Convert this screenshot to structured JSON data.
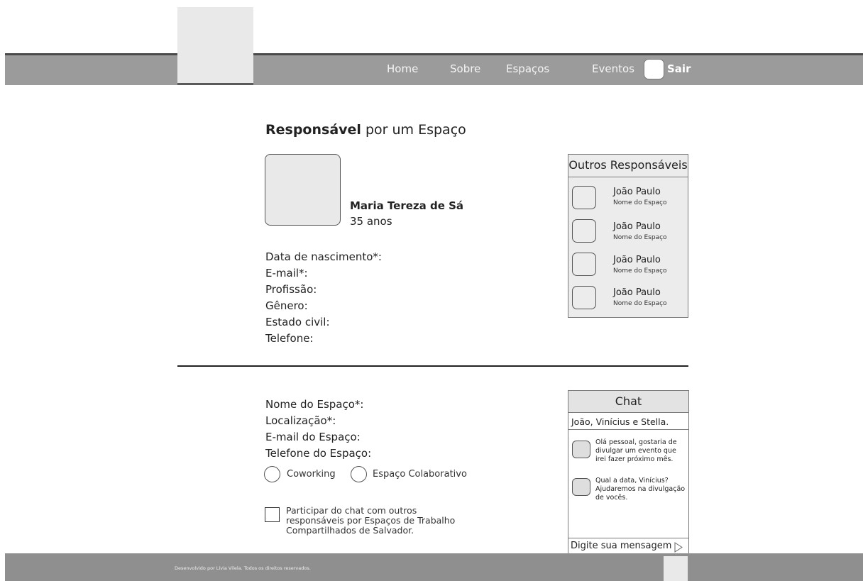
{
  "header": {
    "nav": [
      "Home",
      "Sobre",
      "Espaços",
      "Eventos"
    ],
    "logout_label": "Sair"
  },
  "page": {
    "title_bold": "Responsável",
    "title_rest": " por um Espaço"
  },
  "profile": {
    "name": "Maria Tereza de Sá",
    "age": "35 anos"
  },
  "personal_fields": [
    "Data de nascimento*:",
    "E-mail*:",
    "Profissão:",
    "Gênero:",
    "Estado civil:",
    "Telefone:"
  ],
  "others_panel": {
    "title": "Outros Responsáveis",
    "items": [
      {
        "name": "João Paulo",
        "space": "Nome do Espaço"
      },
      {
        "name": "João Paulo",
        "space": "Nome do Espaço"
      },
      {
        "name": "João Paulo",
        "space": "Nome do Espaço"
      },
      {
        "name": "João Paulo",
        "space": "Nome do Espaço"
      }
    ]
  },
  "space_fields": [
    "Nome do Espaço*:",
    "Localização*:",
    "E-mail do Espaço:",
    "Telefone do Espaço:"
  ],
  "space_type": {
    "options": [
      "Coworking",
      "Espaço Colaborativo"
    ]
  },
  "chat_optin": {
    "label": "Participar do chat com outros responsáveis por Espaços de Trabalho Compartilhados de Salvador."
  },
  "chat": {
    "title": "Chat",
    "participants": "João, Vinícius e Stella.",
    "messages": [
      "Olá pessoal, gostaria de divulgar um evento que irei fazer próximo mês.",
      "Qual a data, Vinícius? Ajudaremos na divulgação de vocês."
    ],
    "input_placeholder": "Digite sua mensagem"
  },
  "footer": {
    "text": "Desenvolvido por Lívia Vilela. Todos os direitos reservados."
  },
  "icons": {
    "send": "triangle-right-icon",
    "toggle": "toggle-icon"
  }
}
